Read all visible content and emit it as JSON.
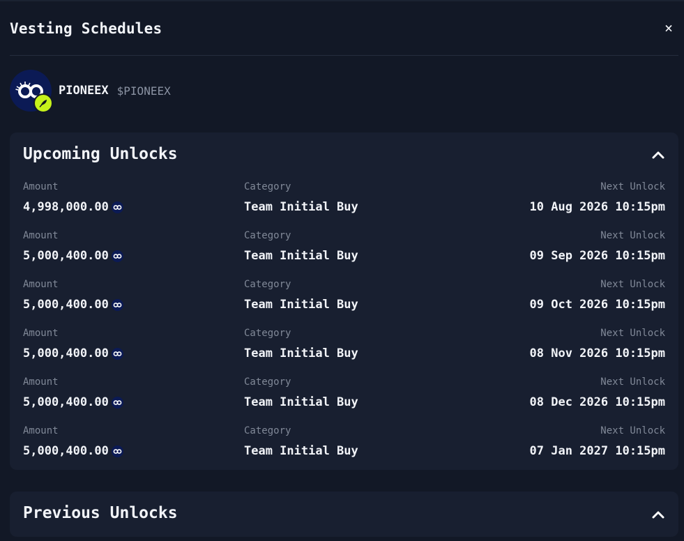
{
  "modal": {
    "title": "Vesting Schedules",
    "close_label": "×"
  },
  "token": {
    "name": "PIONEEX",
    "ticker": "$PIONEEX",
    "icon": "pioneex-logo-icon",
    "badge_icon": "feather-icon",
    "badge_color": "#c6f21b"
  },
  "upcoming": {
    "title": "Upcoming Unlocks",
    "labels": {
      "amount": "Amount",
      "category": "Category",
      "next_unlock": "Next Unlock"
    },
    "rows": [
      {
        "amount": "4,998,000.00",
        "category": "Team Initial Buy",
        "next_unlock": "10 Aug 2026 10:15pm"
      },
      {
        "amount": "5,000,400.00",
        "category": "Team Initial Buy",
        "next_unlock": "09 Sep 2026 10:15pm"
      },
      {
        "amount": "5,000,400.00",
        "category": "Team Initial Buy",
        "next_unlock": "09 Oct 2026 10:15pm"
      },
      {
        "amount": "5,000,400.00",
        "category": "Team Initial Buy",
        "next_unlock": "08 Nov 2026 10:15pm"
      },
      {
        "amount": "5,000,400.00",
        "category": "Team Initial Buy",
        "next_unlock": "08 Dec 2026 10:15pm"
      },
      {
        "amount": "5,000,400.00",
        "category": "Team Initial Buy",
        "next_unlock": "07 Jan 2027 10:15pm"
      }
    ]
  },
  "previous": {
    "title": "Previous Unlocks"
  }
}
